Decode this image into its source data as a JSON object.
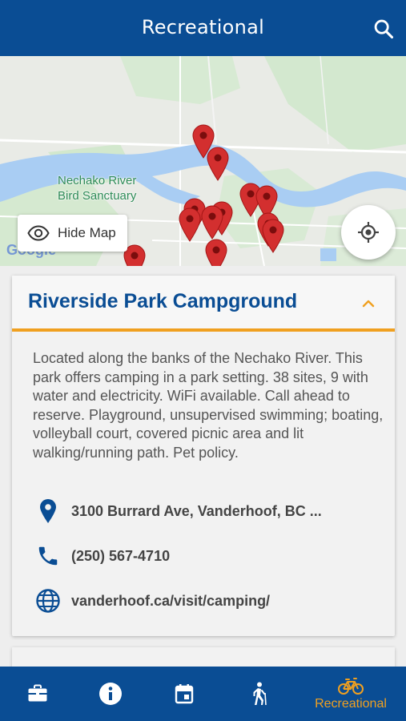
{
  "header": {
    "title": "Recreational"
  },
  "map": {
    "area_label_line1": "Nechako River",
    "area_label_line2": "Bird Sanctuary",
    "google_logo": "Google",
    "hide_map_label": "Hide Map",
    "pin_color": "#d32f2f"
  },
  "listing": {
    "title": "Riverside Park Campground",
    "description": "Located along the banks of the Nechako River. This park offers camping in a park setting. 38 sites, 9 with water and electricity. WiFi available. Call ahead to reserve. Playground, unsupervised swimming; boating, volleyball court, covered picnic area and lit walking/running path. Pet policy.",
    "address": "3100 Burrard Ave, Vanderhoof, BC ...",
    "phone": "(250) 567-4710",
    "website": "vanderhoof.ca/visit/camping/"
  },
  "tabs": [
    {
      "icon": "briefcase-icon",
      "label": ""
    },
    {
      "icon": "info-icon",
      "label": ""
    },
    {
      "icon": "calendar-icon",
      "label": ""
    },
    {
      "icon": "hiker-icon",
      "label": ""
    },
    {
      "icon": "bicycle-icon",
      "label": "Recreational",
      "active": true
    }
  ],
  "colors": {
    "brand": "#0a4d94",
    "accent": "#f0a020"
  }
}
